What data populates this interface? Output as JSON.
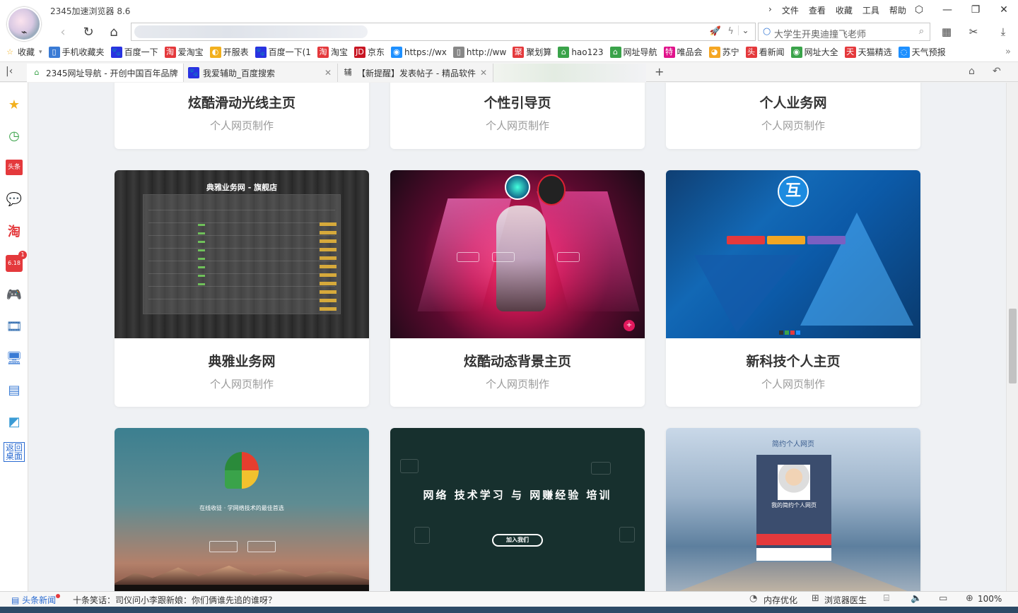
{
  "window": {
    "title": "2345加速浏览器 8.6",
    "menu": [
      "文件",
      "查看",
      "收藏",
      "工具",
      "帮助"
    ]
  },
  "toolbar": {
    "search_text": "大学生开奥迪撞飞老师"
  },
  "bookmarks": [
    {
      "label": "收藏",
      "color": "#f2b01e"
    },
    {
      "label": "手机收藏夹",
      "color": "#3a7bd5"
    },
    {
      "label": "百度一下",
      "color": "#2932e1"
    },
    {
      "label": "爱淘宝",
      "color": "#e4393c"
    },
    {
      "label": "开服表",
      "color": "#f2b01e"
    },
    {
      "label": "百度一下(1",
      "color": "#2932e1"
    },
    {
      "label": "淘宝",
      "color": "#e4393c"
    },
    {
      "label": "京东",
      "color": "#c81623"
    },
    {
      "label": "https://wx",
      "color": "#1e90ff"
    },
    {
      "label": "http://ww",
      "color": "#888888"
    },
    {
      "label": "聚划算",
      "color": "#e4393c"
    },
    {
      "label": "hao123",
      "color": "#3aa34a"
    },
    {
      "label": "网址导航",
      "color": "#3aa34a"
    },
    {
      "label": "唯品会",
      "color": "#e0138b"
    },
    {
      "label": "苏宁",
      "color": "#f5a623"
    },
    {
      "label": "看新闻",
      "color": "#e4393c"
    },
    {
      "label": "网址大全",
      "color": "#3aa34a"
    },
    {
      "label": "天猫精选",
      "color": "#e4393c"
    },
    {
      "label": "天气预报",
      "color": "#1e90ff"
    }
  ],
  "tabs": [
    {
      "label": "2345网址导航 - 开创中国百年品牌",
      "color": "#3aa34a"
    },
    {
      "label": "我爱辅助_百度搜索",
      "color": "#2932e1"
    },
    {
      "label": "【新提醒】发表帖子 - 精品软件",
      "color": "#333333"
    }
  ],
  "sidebar": {
    "back_desktop": "返回桌面",
    "badge": "1"
  },
  "cards": [
    {
      "title": "炫酷滑动光线主页",
      "sub": "个人网页制作"
    },
    {
      "title": "个性引导页",
      "sub": "个人网页制作"
    },
    {
      "title": "个人业务网",
      "sub": "个人网页制作"
    },
    {
      "title": "典雅业务网",
      "sub": "个人网页制作"
    },
    {
      "title": "炫酷动态背景主页",
      "sub": "个人网页制作"
    },
    {
      "title": "新科技个人主页",
      "sub": "个人网页制作"
    }
  ],
  "art": {
    "header1": "典雅业务网 - 旗舰店",
    "logo3": "互",
    "tagline4": "在线收徒 · 学网络技术的最佳首选",
    "head5": "网络 技术学习 与 网赚经验 培训",
    "join5": "加入我们",
    "title6": "简约个人网页",
    "name6": "我的简约个人网页"
  },
  "status": {
    "news_label": "头条新闻",
    "joke": "十条笑话：司仪问小李跟新娘：你们俩谁先追的谁呀？",
    "memory": "内存优化",
    "doctor": "浏览器医生",
    "zoom": "100%"
  }
}
